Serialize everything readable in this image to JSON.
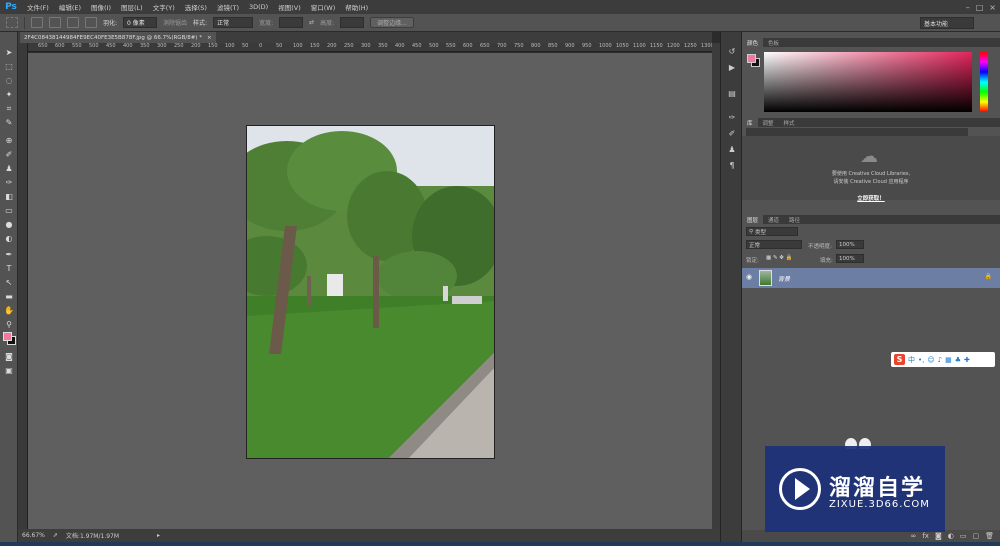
{
  "app": {
    "logo": "Ps"
  },
  "menu": [
    "文件(F)",
    "编辑(E)",
    "图像(I)",
    "图层(L)",
    "文字(Y)",
    "选择(S)",
    "滤镜(T)",
    "3D(D)",
    "视图(V)",
    "窗口(W)",
    "帮助(H)"
  ],
  "options": {
    "feather_label": "羽化:",
    "feather_value": "0 像素",
    "antialias_label": "消除锯齿",
    "style_label": "样式:",
    "style_value": "正常",
    "width_label": "宽度:",
    "height_label": "高度:",
    "refine_edge": "调整边缘...",
    "workspace": "基本功能"
  },
  "document": {
    "tab_title": "2F4C08438144984FE9EC40FE3E5B878F.jpg @ 66.7%(RGB/8#) *"
  },
  "ruler": [
    "650",
    "600",
    "550",
    "500",
    "450",
    "400",
    "350",
    "300",
    "250",
    "200",
    "150",
    "100",
    "50",
    "0",
    "50",
    "100",
    "150",
    "200",
    "250",
    "300",
    "350",
    "400",
    "450",
    "500",
    "550",
    "600",
    "650",
    "700",
    "750",
    "800",
    "850",
    "900",
    "950",
    "1000",
    "1050",
    "1100",
    "1150",
    "1200",
    "1250",
    "1300"
  ],
  "status": {
    "zoom": "66.67%",
    "doc_size": "文档:1.97M/1.97M"
  },
  "panels": {
    "color_tabs": [
      "颜色",
      "色板"
    ],
    "library_tabs": [
      "库",
      "调整",
      "样式"
    ],
    "library_line1": "要使用 Creative Cloud Libraries,",
    "library_line2": "请安装 Creative Cloud 应用程序",
    "library_login": "立即获取！",
    "layer_tabs": [
      "图层",
      "通道",
      "路径"
    ],
    "filter_kind": "类型",
    "blend_mode": "正常",
    "opacity_label": "不透明度:",
    "opacity_value": "100%",
    "lock_label": "锁定:",
    "fill_label": "填充:",
    "fill_value": "100%",
    "layer_name": "背景"
  },
  "ime": {
    "label": "中"
  },
  "watermark": {
    "title": "溜溜自学",
    "url": "ZIXUE.3D66.COM"
  },
  "colors": {
    "foreground": "#f07a9b",
    "background": "#111111",
    "layer_selected": "#6c7ea3",
    "watermark": "#1c3078"
  }
}
